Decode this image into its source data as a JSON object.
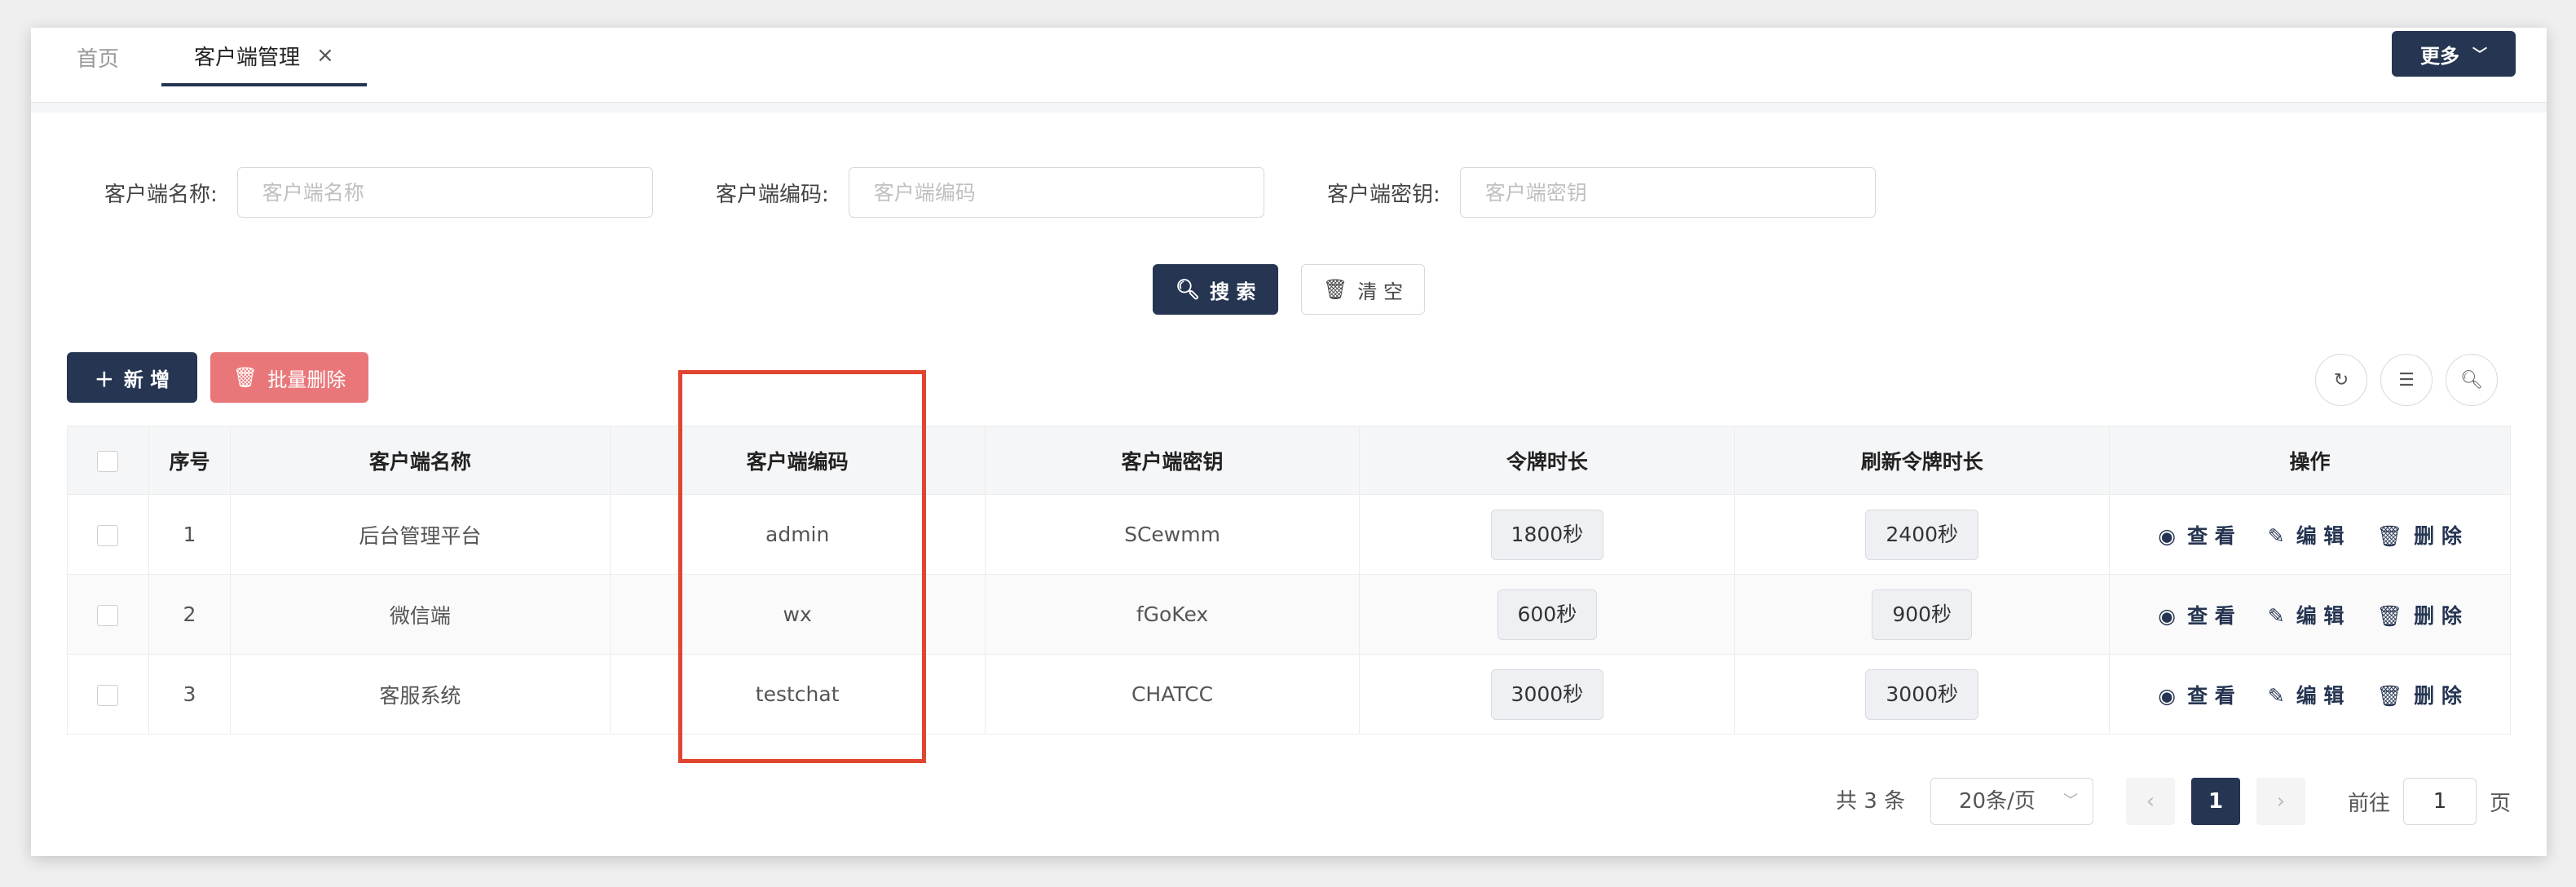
{
  "tabs": {
    "home": "首页",
    "active": "客户端管理",
    "close_glyph": "×",
    "more_label": "更多"
  },
  "search_form": {
    "name_label": "客户端名称:",
    "name_placeholder": "客户端名称",
    "code_label": "客户端编码:",
    "code_placeholder": "客户端编码",
    "secret_label": "客户端密钥:",
    "secret_placeholder": "客户端密钥",
    "search_button": "搜 索",
    "clear_button": "清 空"
  },
  "toolbar": {
    "add_button": "新 增",
    "batch_delete_button": "批量删除"
  },
  "table": {
    "columns": [
      "序号",
      "客户端名称",
      "客户端编码",
      "客户端密钥",
      "令牌时长",
      "刷新令牌时长",
      "操作"
    ],
    "rows": [
      {
        "index": "1",
        "name": "后台管理平台",
        "code": "admin",
        "secret": "SCewmm",
        "token": "1800秒",
        "refresh": "2400秒"
      },
      {
        "index": "2",
        "name": "微信端",
        "code": "wx",
        "secret": "fGoKex",
        "token": "600秒",
        "refresh": "900秒"
      },
      {
        "index": "3",
        "name": "客服系统",
        "code": "testchat",
        "secret": "CHATCC",
        "token": "3000秒",
        "refresh": "3000秒"
      }
    ],
    "ops": {
      "view": "查 看",
      "edit": "编 辑",
      "delete": "删 除"
    }
  },
  "pagination": {
    "total": "共 3 条",
    "page_size": "20条/页",
    "current": "1",
    "goto_prefix": "前往",
    "goto_value": "1",
    "goto_suffix": "页"
  },
  "colors": {
    "primary": "#253552",
    "danger": "#e97779",
    "highlight": "#e0452f"
  }
}
